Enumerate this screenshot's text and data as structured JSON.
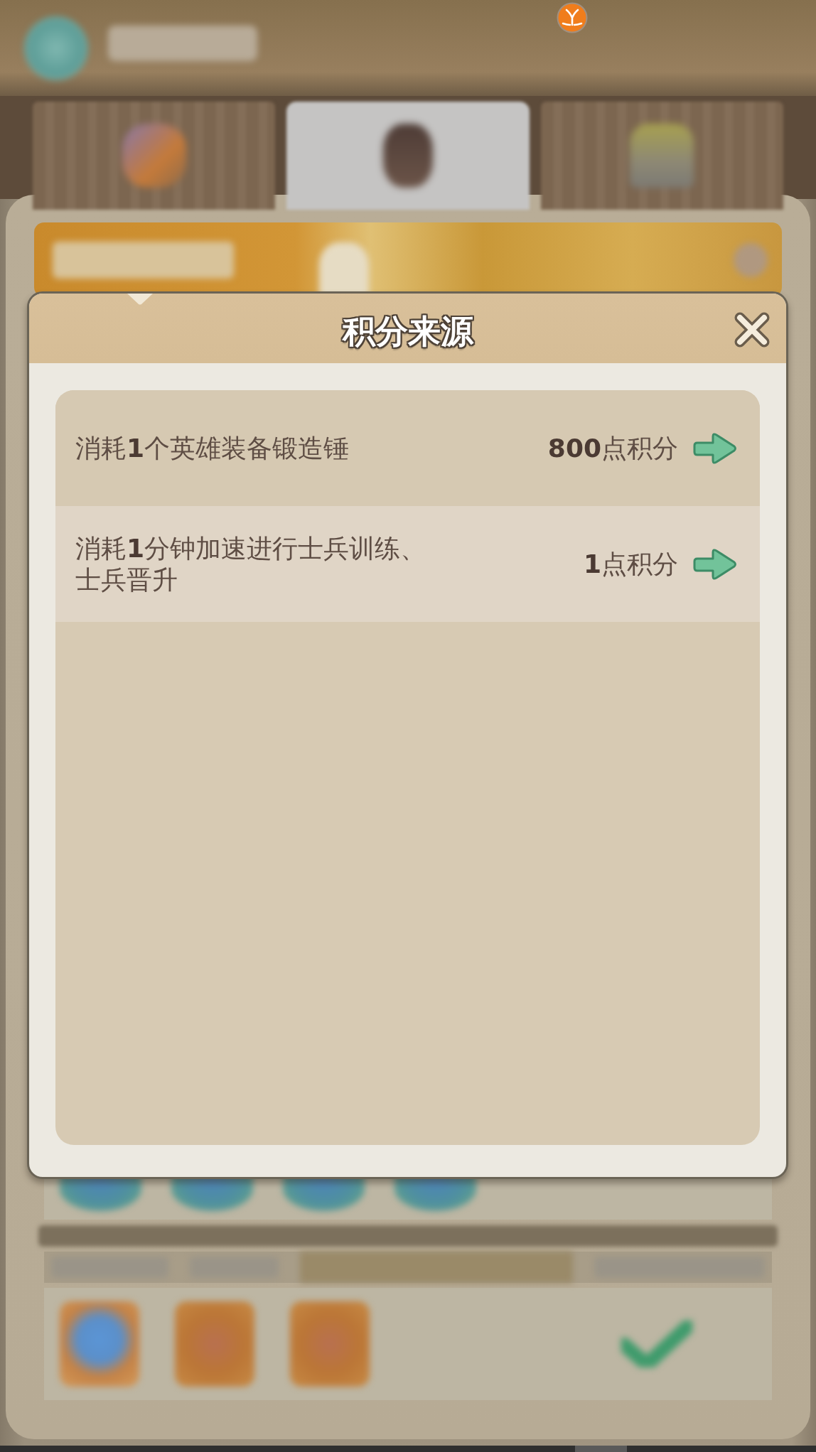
{
  "top_bar": {
    "tabs": [
      {
        "selected": false
      },
      {
        "selected": true
      },
      {
        "selected": false
      }
    ]
  },
  "dialog": {
    "title": "积分来源",
    "rows": [
      {
        "description": "消耗**1**个英雄装备锻造锤",
        "points": "**800**点积分"
      },
      {
        "description": "消耗**1**分钟加速进行士兵训练、士兵晋升",
        "points": "**1**点积分"
      }
    ]
  }
}
